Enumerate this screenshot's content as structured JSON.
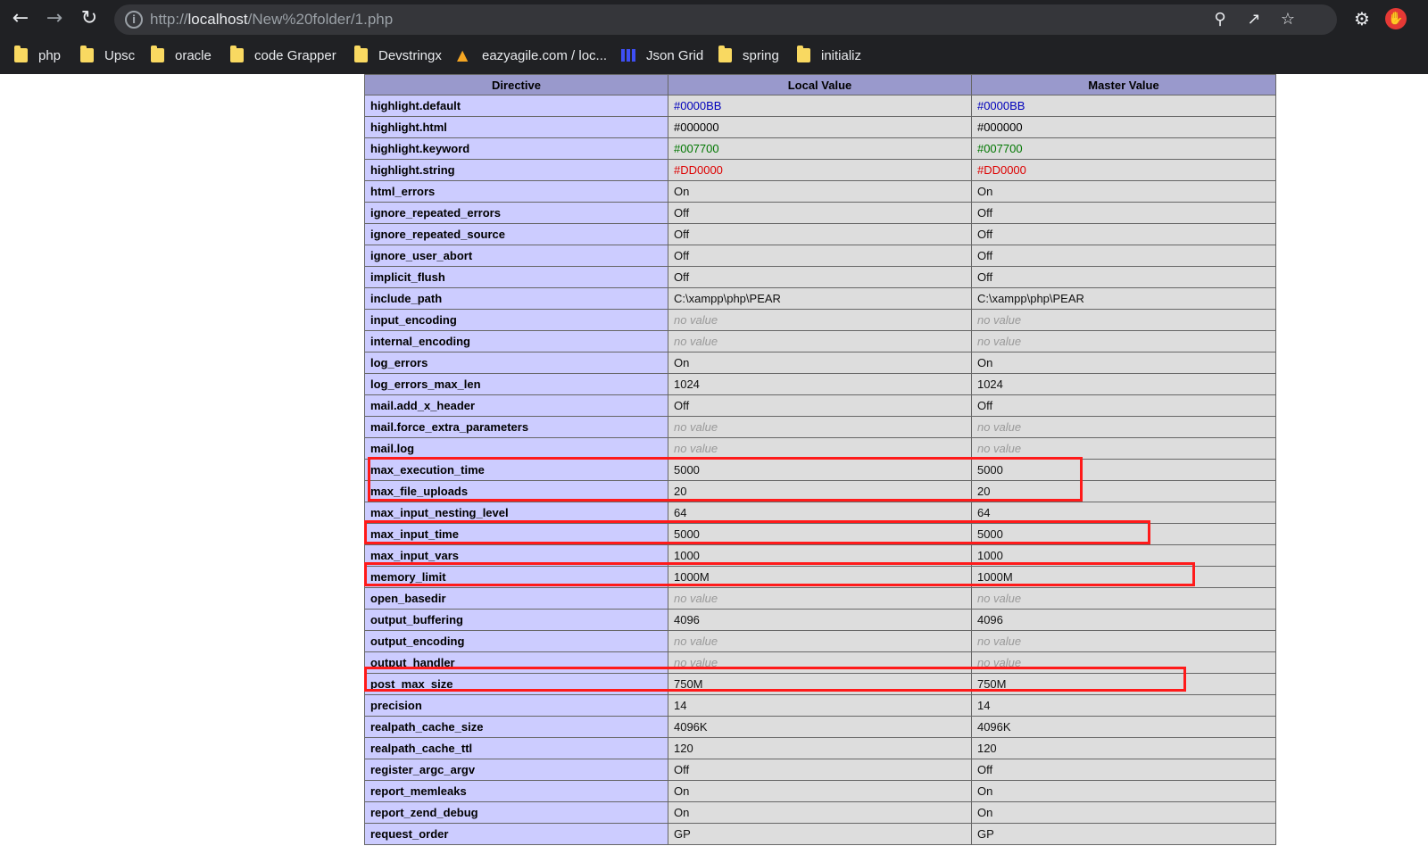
{
  "browser": {
    "url_prefix": "http://",
    "url_host": "localhost",
    "url_path": "/New%20folder/1.php",
    "back_icon": "back-arrow-icon",
    "forward_icon": "forward-arrow-icon",
    "reload_icon": "reload-icon",
    "info_icon": "info-icon",
    "zoom_icon": "zoom-icon",
    "share_icon": "share-icon",
    "star_icon": "star-icon",
    "ext1_icon": "gear-extension-icon",
    "ext2_icon": "hand-extension-icon"
  },
  "bookmarks": [
    {
      "label": "php",
      "icon": "folder-icon"
    },
    {
      "label": "Upsc",
      "icon": "folder-icon"
    },
    {
      "label": "oracle",
      "icon": "folder-icon"
    },
    {
      "label": "code Grapper",
      "icon": "folder-icon"
    },
    {
      "label": "Devstringx",
      "icon": "folder-icon"
    },
    {
      "label": "eazyagile.com / loc...",
      "icon": "eazyagile-icon"
    },
    {
      "label": "Json Grid",
      "icon": "grid-icon"
    },
    {
      "label": "spring",
      "icon": "folder-icon"
    },
    {
      "label": "initializ",
      "icon": "folder-icon"
    }
  ],
  "table": {
    "headers": [
      "Directive",
      "Local Value",
      "Master Value"
    ],
    "rows": [
      {
        "d": "highlight.default",
        "l": "#0000BB",
        "m": "#0000BB",
        "color": "#0000BB"
      },
      {
        "d": "highlight.html",
        "l": "#000000",
        "m": "#000000",
        "color": "#000000"
      },
      {
        "d": "highlight.keyword",
        "l": "#007700",
        "m": "#007700",
        "color": "#007700"
      },
      {
        "d": "highlight.string",
        "l": "#DD0000",
        "m": "#DD0000",
        "color": "#DD0000"
      },
      {
        "d": "html_errors",
        "l": "On",
        "m": "On"
      },
      {
        "d": "ignore_repeated_errors",
        "l": "Off",
        "m": "Off"
      },
      {
        "d": "ignore_repeated_source",
        "l": "Off",
        "m": "Off"
      },
      {
        "d": "ignore_user_abort",
        "l": "Off",
        "m": "Off"
      },
      {
        "d": "implicit_flush",
        "l": "Off",
        "m": "Off"
      },
      {
        "d": "include_path",
        "l": "C:\\xampp\\php\\PEAR",
        "m": "C:\\xampp\\php\\PEAR"
      },
      {
        "d": "input_encoding",
        "l": "no value",
        "m": "no value",
        "nv": true
      },
      {
        "d": "internal_encoding",
        "l": "no value",
        "m": "no value",
        "nv": true
      },
      {
        "d": "log_errors",
        "l": "On",
        "m": "On"
      },
      {
        "d": "log_errors_max_len",
        "l": "1024",
        "m": "1024"
      },
      {
        "d": "mail.add_x_header",
        "l": "Off",
        "m": "Off"
      },
      {
        "d": "mail.force_extra_parameters",
        "l": "no value",
        "m": "no value",
        "nv": true
      },
      {
        "d": "mail.log",
        "l": "no value",
        "m": "no value",
        "nv": true
      },
      {
        "d": "max_execution_time",
        "l": "5000",
        "m": "5000"
      },
      {
        "d": "max_file_uploads",
        "l": "20",
        "m": "20"
      },
      {
        "d": "max_input_nesting_level",
        "l": "64",
        "m": "64"
      },
      {
        "d": "max_input_time",
        "l": "5000",
        "m": "5000"
      },
      {
        "d": "max_input_vars",
        "l": "1000",
        "m": "1000"
      },
      {
        "d": "memory_limit",
        "l": "1000M",
        "m": "1000M"
      },
      {
        "d": "open_basedir",
        "l": "no value",
        "m": "no value",
        "nv": true
      },
      {
        "d": "output_buffering",
        "l": "4096",
        "m": "4096"
      },
      {
        "d": "output_encoding",
        "l": "no value",
        "m": "no value",
        "nv": true
      },
      {
        "d": "output_handler",
        "l": "no value",
        "m": "no value",
        "nv": true
      },
      {
        "d": "post_max_size",
        "l": "750M",
        "m": "750M"
      },
      {
        "d": "precision",
        "l": "14",
        "m": "14"
      },
      {
        "d": "realpath_cache_size",
        "l": "4096K",
        "m": "4096K"
      },
      {
        "d": "realpath_cache_ttl",
        "l": "120",
        "m": "120"
      },
      {
        "d": "register_argc_argv",
        "l": "Off",
        "m": "Off"
      },
      {
        "d": "report_memleaks",
        "l": "On",
        "m": "On"
      },
      {
        "d": "report_zend_debug",
        "l": "On",
        "m": "On"
      },
      {
        "d": "request_order",
        "l": "GP",
        "m": "GP"
      }
    ]
  },
  "highlight_color": "#ff1a1a"
}
